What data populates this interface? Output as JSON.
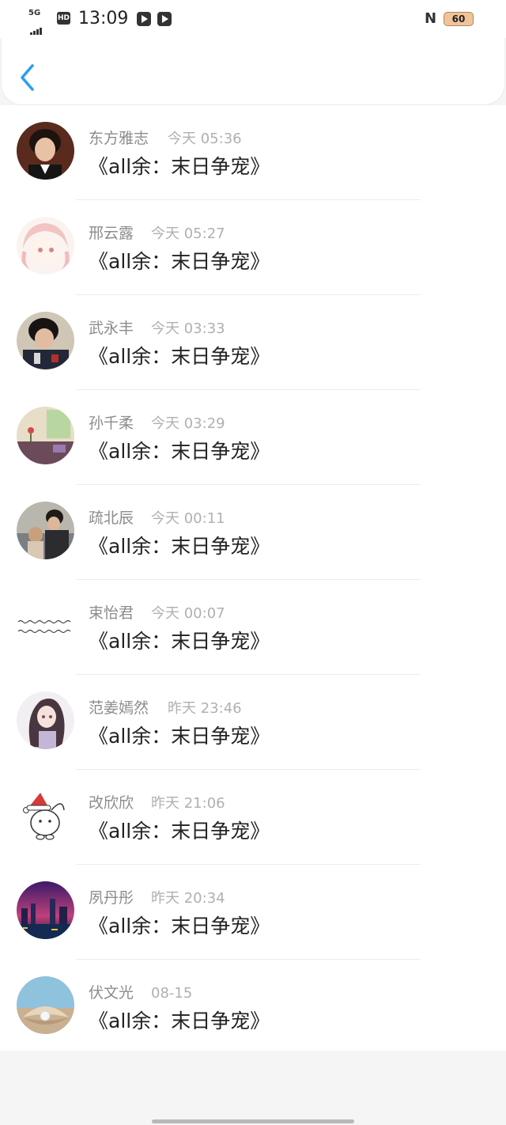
{
  "status_bar": {
    "network": "5G",
    "hd_badge": "HD",
    "time": "13:09",
    "nfc_symbol": "N",
    "battery": "60"
  },
  "nav": {
    "back_icon": "chevron-left-icon",
    "accent_color": "#2b9ef0"
  },
  "items": [
    {
      "name": "东方雅志",
      "time": "今天 05:36",
      "message": "《all余：末日争宠》",
      "avatar_icon": "boy-portrait-avatar"
    },
    {
      "name": "邢云露",
      "time": "今天 05:27",
      "message": "《all余：末日争宠》",
      "avatar_icon": "anime-girl-sketch-avatar"
    },
    {
      "name": "武永丰",
      "time": "今天 03:33",
      "message": "《all余：末日争宠》",
      "avatar_icon": "boy-hoodie-avatar"
    },
    {
      "name": "孙千柔",
      "time": "今天 03:29",
      "message": "《all余：末日争宠》",
      "avatar_icon": "window-scene-avatar"
    },
    {
      "name": "疏北辰",
      "time": "今天 00:11",
      "message": "《all余：末日争宠》",
      "avatar_icon": "couple-photo-avatar"
    },
    {
      "name": "束怡君",
      "time": "今天 00:07",
      "message": "《all余：末日争宠》",
      "avatar_icon": "handwriting-text-avatar"
    },
    {
      "name": "范姜嫣然",
      "time": "昨天 23:46",
      "message": "《all余：末日争宠》",
      "avatar_icon": "anime-girl-avatar"
    },
    {
      "name": "改欣欣",
      "time": "昨天 21:06",
      "message": "《all余：末日争宠》",
      "avatar_icon": "christmas-bunny-avatar"
    },
    {
      "name": "夙丹彤",
      "time": "昨天 20:34",
      "message": "《all余：末日争宠》",
      "avatar_icon": "night-city-avatar"
    },
    {
      "name": "伏文光",
      "time": "08-15",
      "message": "《all余：末日争宠》",
      "avatar_icon": "pearl-shell-avatar"
    }
  ]
}
